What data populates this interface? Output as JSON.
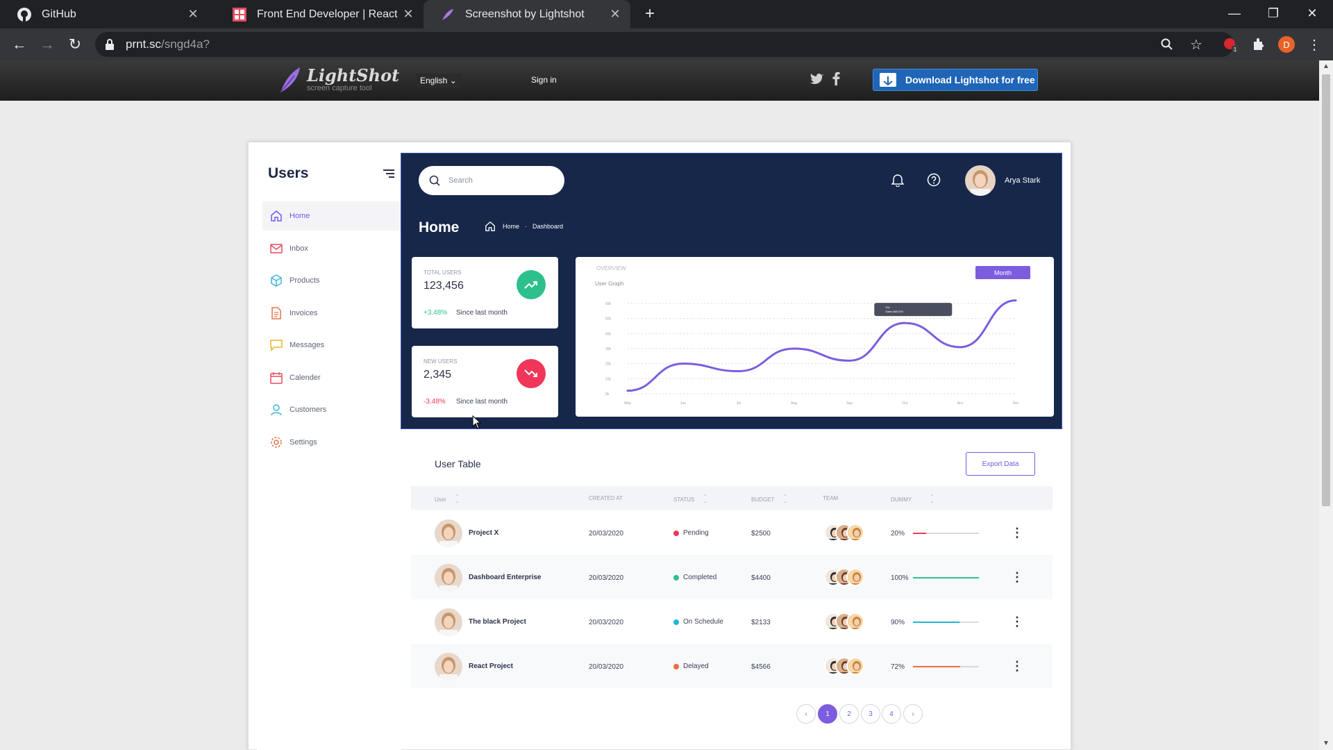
{
  "browser": {
    "tabs": [
      {
        "title": "GitHub"
      },
      {
        "title": "Front End Developer | React"
      },
      {
        "title": "Screenshot by Lightshot"
      }
    ],
    "url_host": "prnt.sc",
    "url_path": "/sngd4a?",
    "profile_initial": "D",
    "extension_badge": "1"
  },
  "lightshot": {
    "logo_name": "LightShot",
    "logo_tagline": "screen capture tool",
    "language": "English",
    "sign_in": "Sign in",
    "download_label": "Download Lightshot for free"
  },
  "sidebar": {
    "title": "Users",
    "items": [
      {
        "label": "Home",
        "icon": "home-icon",
        "color": "#6c5ce7"
      },
      {
        "label": "Inbox",
        "icon": "mail-icon",
        "color": "#e84a5f"
      },
      {
        "label": "Products",
        "icon": "box-icon",
        "color": "#3db5d8"
      },
      {
        "label": "Invoices",
        "icon": "document-icon",
        "color": "#e8734a"
      },
      {
        "label": "Messages",
        "icon": "chat-icon",
        "color": "#f0b429"
      },
      {
        "label": "Calender",
        "icon": "calendar-icon",
        "color": "#e84a5f"
      },
      {
        "label": "Customers",
        "icon": "user-icon",
        "color": "#3db5d8"
      },
      {
        "label": "Settings",
        "icon": "gear-icon",
        "color": "#e8734a"
      }
    ]
  },
  "header": {
    "search_placeholder": "Search",
    "user_name": "Arya Stark",
    "page_title": "Home",
    "breadcrumb": [
      "Home",
      "Dashboard"
    ]
  },
  "stats": [
    {
      "label": "Total Users",
      "value": "123,456",
      "change": "+3.48%",
      "since": "Since last month",
      "trend": "up",
      "color": "#2ec08c"
    },
    {
      "label": "New Users",
      "value": "2,345",
      "change": "-3.48%",
      "since": "Since last month",
      "trend": "down",
      "color": "#f0365a"
    }
  ],
  "chart": {
    "overview_label": "Overview",
    "subtitle": "User Graph",
    "month_button": "Month",
    "tooltip_title": "Oct",
    "tooltip_text": "Sales $65,000"
  },
  "chart_data": {
    "type": "line",
    "title": "User Graph",
    "x": [
      "May",
      "Jun",
      "Jul",
      "Aug",
      "Sep",
      "Oct",
      "Nov",
      "Dec"
    ],
    "ylim": [
      0,
      60
    ],
    "y_ticks": [
      "60k",
      "50k",
      "40k",
      "30k",
      "20k",
      "10k",
      "0k"
    ],
    "grid": true,
    "series": [
      {
        "values": [
          2,
          20,
          15,
          30,
          22,
          47,
          31,
          62
        ]
      }
    ],
    "line_color": "#7c5cdf"
  },
  "table": {
    "title": "User Table",
    "export_label": "Export Data",
    "columns": [
      "User",
      "Created At",
      "Status",
      "Budget",
      "Team",
      "Dummy"
    ],
    "rows": [
      {
        "name": "Project X",
        "created": "20/03/2020",
        "status": "Pending",
        "status_color": "#f0365a",
        "budget": "$2500",
        "dummy": "20%",
        "dummy_value": 0.2,
        "dummy_color": "#f0365a"
      },
      {
        "name": "Dashboard Enterprise",
        "created": "20/03/2020",
        "status": "Completed",
        "status_color": "#2ec08c",
        "budget": "$4400",
        "dummy": "100%",
        "dummy_value": 1.0,
        "dummy_color": "#2ec08c"
      },
      {
        "name": "The black Project",
        "created": "20/03/2020",
        "status": "On Schedule",
        "status_color": "#1fb6d6",
        "budget": "$2133",
        "dummy": "90%",
        "dummy_value": 0.7,
        "dummy_color": "#1fb6d6"
      },
      {
        "name": "React Project",
        "created": "20/03/2020",
        "status": "Delayed",
        "status_color": "#f26a3d",
        "budget": "$4566",
        "dummy": "72%",
        "dummy_value": 0.72,
        "dummy_color": "#f26a3d"
      }
    ],
    "pages": [
      "1",
      "2",
      "3",
      "4"
    ],
    "current_page": "1"
  }
}
